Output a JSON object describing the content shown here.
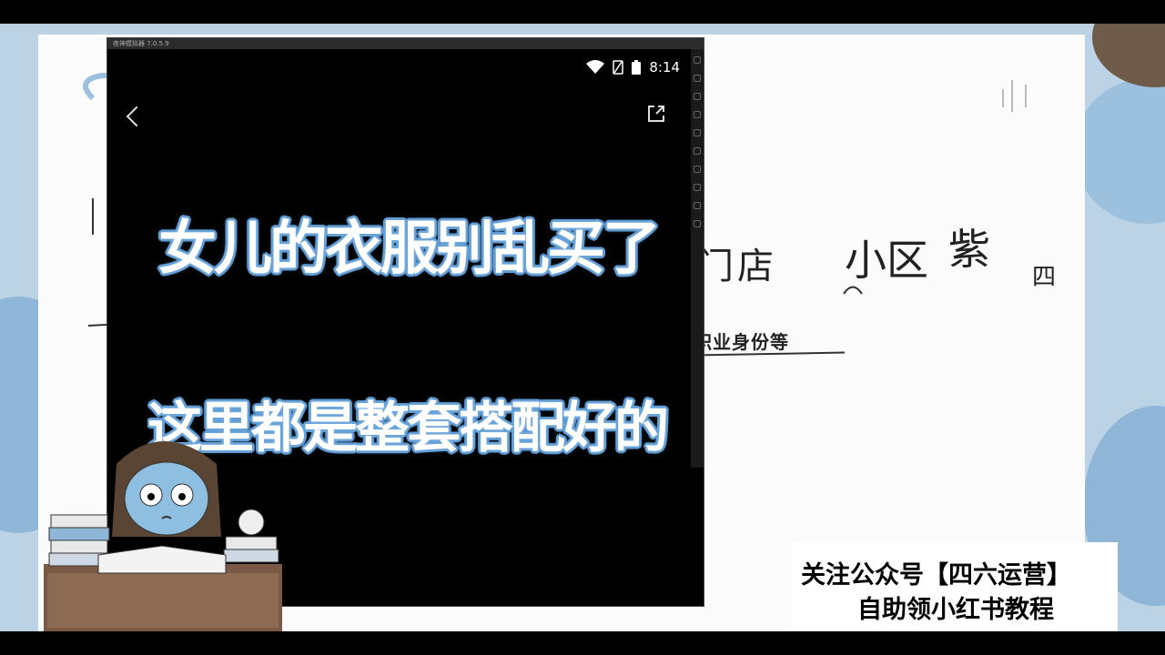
{
  "phone": {
    "window_title": "夜神模拟器 7.0.5.9",
    "status_time": "8:14",
    "captions": [
      "女儿的衣服别乱买了",
      "这里都是整套搭配好的"
    ]
  },
  "whiteboard": {
    "handwriting": [
      "门店",
      "小区",
      "紫",
      "四"
    ],
    "label": "职业身份等"
  },
  "watermark": {
    "line1": "关注公众号【四六运营】",
    "line2": "自助领小红书教程"
  },
  "colors": {
    "caption_outline": "#5d99d2",
    "stage_bg": "#bcd3e6"
  }
}
